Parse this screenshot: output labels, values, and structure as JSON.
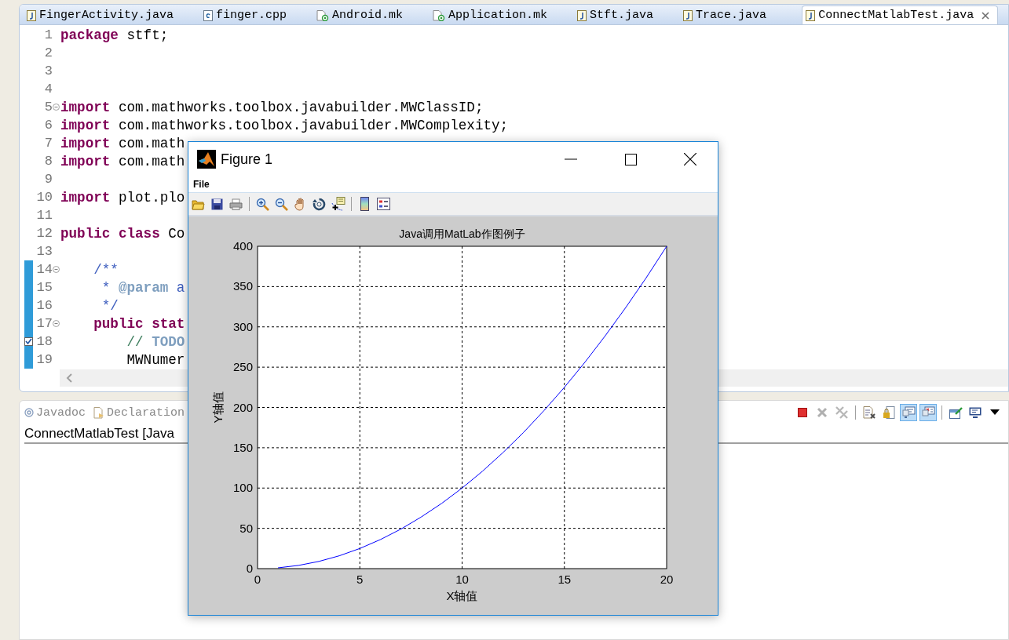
{
  "editor_tabs": [
    {
      "label": "FingerActivity.java",
      "kind": "java",
      "selected": false
    },
    {
      "label": "finger.cpp",
      "kind": "cpp",
      "selected": false
    },
    {
      "label": "Android.mk",
      "kind": "mk",
      "selected": false
    },
    {
      "label": "Application.mk",
      "kind": "mk",
      "selected": false
    },
    {
      "label": "Stft.java",
      "kind": "java",
      "selected": false
    },
    {
      "label": "Trace.java",
      "kind": "java",
      "selected": false
    },
    {
      "label": "ConnectMatlabTest.java",
      "kind": "java",
      "selected": true
    }
  ],
  "code_lines": [
    {
      "number": "1",
      "tokens": [
        {
          "kind": "keyword",
          "text": "package"
        },
        {
          "kind": "plain",
          "text": " stft;"
        }
      ],
      "foldable": false,
      "changed": false,
      "task": false
    },
    {
      "number": "2",
      "foldable": false,
      "changed": false,
      "task": false
    },
    {
      "number": "3",
      "foldable": false,
      "changed": false,
      "task": false
    },
    {
      "number": "4",
      "foldable": false,
      "changed": false,
      "task": false
    },
    {
      "number": "5",
      "tokens": [
        {
          "kind": "keyword",
          "text": "import"
        },
        {
          "kind": "plain",
          "text": " com.mathworks.toolbox.javabuilder.MWClassID;"
        }
      ],
      "foldable": true,
      "changed": false,
      "task": false
    },
    {
      "number": "6",
      "tokens": [
        {
          "kind": "keyword",
          "text": "import"
        },
        {
          "kind": "plain",
          "text": " com.mathworks.toolbox.javabuilder.MWComplexity;"
        }
      ],
      "foldable": false,
      "changed": false,
      "task": false
    },
    {
      "number": "7",
      "tokens": [
        {
          "kind": "keyword",
          "text": "import"
        },
        {
          "kind": "plain",
          "text": " com.math"
        }
      ],
      "foldable": false,
      "changed": false,
      "task": false
    },
    {
      "number": "8",
      "tokens": [
        {
          "kind": "keyword",
          "text": "import"
        },
        {
          "kind": "plain",
          "text": " com.math"
        }
      ],
      "foldable": false,
      "changed": false,
      "task": false
    },
    {
      "number": "9",
      "foldable": false,
      "changed": false,
      "task": false
    },
    {
      "number": "10",
      "tokens": [
        {
          "kind": "keyword",
          "text": "import"
        },
        {
          "kind": "plain",
          "text": " plot.plo"
        }
      ],
      "foldable": false,
      "changed": false,
      "task": false
    },
    {
      "number": "11",
      "foldable": false,
      "changed": false,
      "task": false
    },
    {
      "number": "12",
      "tokens": [
        {
          "kind": "keyword",
          "text": "public class"
        },
        {
          "kind": "plain",
          "text": " Co"
        }
      ],
      "foldable": false,
      "changed": false,
      "task": false
    },
    {
      "number": "13",
      "foldable": false,
      "changed": false,
      "task": false
    },
    {
      "number": "14",
      "tokens": [
        {
          "kind": "javadoc",
          "text": "    /**"
        }
      ],
      "foldable": true,
      "changed": true,
      "task": false
    },
    {
      "number": "15",
      "tokens": [
        {
          "kind": "javadoc",
          "text": "     * "
        },
        {
          "kind": "javadoc-tag",
          "text": "@param"
        },
        {
          "kind": "javadoc",
          "text": " a"
        }
      ],
      "foldable": false,
      "changed": true,
      "task": false
    },
    {
      "number": "16",
      "tokens": [
        {
          "kind": "javadoc",
          "text": "     */"
        }
      ],
      "foldable": false,
      "changed": true,
      "task": false
    },
    {
      "number": "17",
      "tokens": [
        {
          "kind": "keyword",
          "text": "    public stat"
        }
      ],
      "foldable": true,
      "changed": true,
      "task": false
    },
    {
      "number": "18",
      "tokens": [
        {
          "kind": "comment",
          "text": "        // "
        },
        {
          "kind": "javadoc-tag",
          "text": "TODO"
        }
      ],
      "foldable": false,
      "changed": true,
      "task": true
    },
    {
      "number": "19",
      "tokens": [
        {
          "kind": "plain",
          "text": "        MWNumer"
        }
      ],
      "foldable": false,
      "changed": true,
      "task": false
    }
  ],
  "console_view": {
    "tabs": [
      {
        "label": "Javadoc",
        "kind": "javadoc"
      },
      {
        "label": "Declaration",
        "kind": "declaration"
      }
    ],
    "toolbar": [
      {
        "kind": "terminate",
        "selected": false
      },
      {
        "kind": "remove",
        "selected": false
      },
      {
        "kind": "remove-all",
        "selected": false
      },
      {
        "kind": "separator"
      },
      {
        "kind": "document",
        "selected": false
      },
      {
        "kind": "lock",
        "selected": false
      },
      {
        "kind": "console",
        "selected": true
      },
      {
        "kind": "console-error",
        "selected": true
      },
      {
        "kind": "separator"
      },
      {
        "kind": "new-console",
        "selected": false
      },
      {
        "kind": "display",
        "selected": false
      },
      {
        "kind": "menu",
        "selected": false
      }
    ],
    "title": "ConnectMatlabTest [Java"
  },
  "figure": {
    "title": "Figure 1",
    "menu": [
      "File"
    ],
    "toolbar": [
      {
        "kind": "open"
      },
      {
        "kind": "save"
      },
      {
        "kind": "print"
      },
      {
        "kind": "separator"
      },
      {
        "kind": "zoom-in"
      },
      {
        "kind": "zoom-out"
      },
      {
        "kind": "pan"
      },
      {
        "kind": "rotate"
      },
      {
        "kind": "data-cursor"
      },
      {
        "kind": "separator"
      },
      {
        "kind": "colorbar"
      },
      {
        "kind": "legend"
      }
    ],
    "chart_data": {
      "type": "line",
      "title": "Java调用MatLab作图例子",
      "xlabel": "X轴值",
      "ylabel": "Y轴值",
      "x": [
        1,
        2,
        3,
        4,
        5,
        6,
        7,
        8,
        9,
        10,
        11,
        12,
        13,
        14,
        15,
        16,
        17,
        18,
        19,
        20
      ],
      "series": [
        {
          "color": "#0000ff",
          "values": [
            1,
            4,
            9,
            16,
            25,
            36,
            49,
            64,
            81,
            100,
            121,
            144,
            169,
            196,
            225,
            256,
            289,
            324,
            361,
            400
          ]
        }
      ],
      "grid": true,
      "xlim": [
        0,
        20
      ],
      "ylim": [
        0,
        400
      ],
      "xticks": [
        0,
        5,
        10,
        15,
        20
      ],
      "yticks": [
        0,
        50,
        100,
        150,
        200,
        250,
        300,
        350,
        400
      ]
    }
  }
}
